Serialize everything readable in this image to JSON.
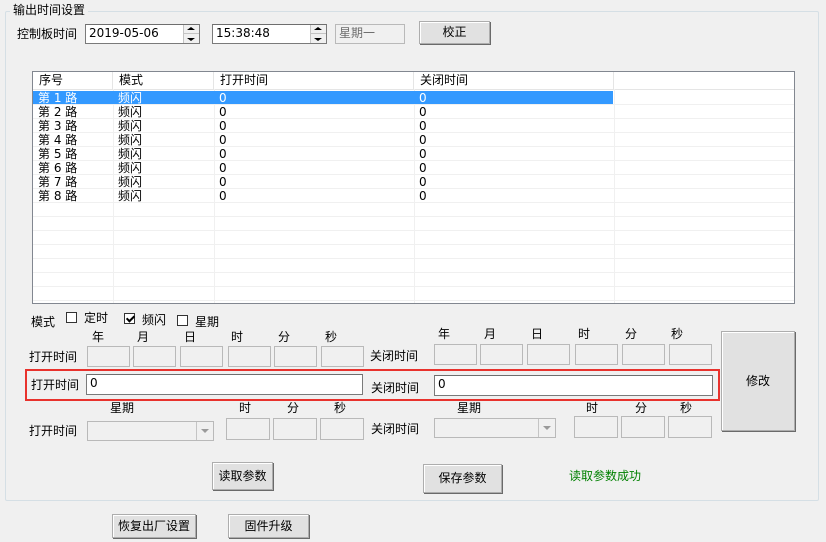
{
  "group": {
    "title": "输出时间设置"
  },
  "control": {
    "label": "控制板时间",
    "date": "2019-05-06",
    "time": "15:38:48",
    "weekday": "星期一",
    "calibrate_label": "校正"
  },
  "list": {
    "columns": [
      "序号",
      "模式",
      "打开时间",
      "关闭时间"
    ],
    "rows": [
      {
        "id": "第 1 路",
        "mode": "频闪",
        "open": "0",
        "close": "0",
        "selected": true
      },
      {
        "id": "第 2 路",
        "mode": "频闪",
        "open": "0",
        "close": "0"
      },
      {
        "id": "第 3 路",
        "mode": "频闪",
        "open": "0",
        "close": "0"
      },
      {
        "id": "第 4 路",
        "mode": "频闪",
        "open": "0",
        "close": "0"
      },
      {
        "id": "第 5 路",
        "mode": "频闪",
        "open": "0",
        "close": "0"
      },
      {
        "id": "第 6 路",
        "mode": "频闪",
        "open": "0",
        "close": "0"
      },
      {
        "id": "第 7 路",
        "mode": "频闪",
        "open": "0",
        "close": "0"
      },
      {
        "id": "第 8 路",
        "mode": "频闪",
        "open": "0",
        "close": "0"
      }
    ]
  },
  "mode": {
    "label": "模式",
    "options": [
      {
        "label": "定时",
        "checked": false
      },
      {
        "label": "频闪",
        "checked": true
      },
      {
        "label": "星期",
        "checked": false
      }
    ]
  },
  "date_row": {
    "open_label": "打开时间",
    "close_label": "关闭时间",
    "headers": [
      "年",
      "月",
      "日",
      "时",
      "分",
      "秒"
    ]
  },
  "flash_row": {
    "open_label": "打开时间",
    "open_value": "0",
    "close_label": "关闭时间",
    "close_value": "0"
  },
  "week_row": {
    "open_label": "打开时间",
    "close_label": "关闭时间",
    "week_header": "星期",
    "time_headers": [
      "时",
      "分",
      "秒"
    ]
  },
  "buttons": {
    "modify": "修改",
    "read": "读取参数",
    "save": "保存参数",
    "restore": "恢复出厂设置",
    "firmware": "固件升级"
  },
  "status": {
    "text": "读取参数成功",
    "color": "#008000"
  }
}
